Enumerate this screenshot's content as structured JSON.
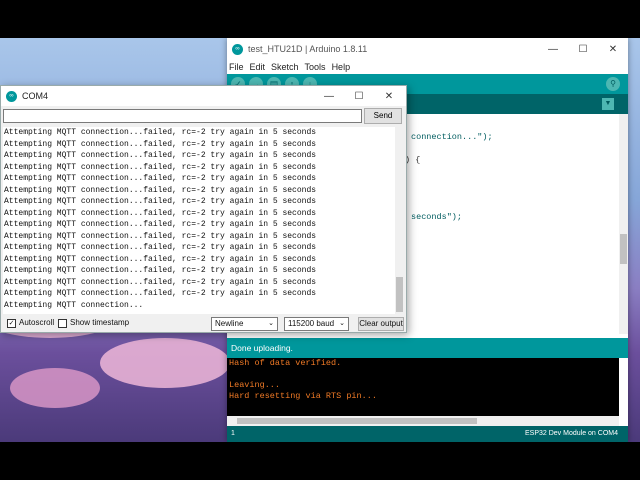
{
  "ide": {
    "title": "test_HTU21D | Arduino 1.8.11",
    "menu": [
      "File",
      "Edit",
      "Sketch",
      "Tools",
      "Help"
    ],
    "editor_fragments": [
      "connection...\");",
      ") {",
      "seconds\");"
    ],
    "status": "Done uploading.",
    "console": [
      "Hash of data verified.",
      "",
      "Leaving...",
      "Hard resetting via RTS pin..."
    ],
    "line_number": "1",
    "board": "ESP32 Dev Module on COM4"
  },
  "serial": {
    "title": "COM4",
    "send_label": "Send",
    "input_value": "",
    "lines": [
      "Attempting MQTT connection...failed, rc=-2 try again in 5 seconds",
      "Attempting MQTT connection...failed, rc=-2 try again in 5 seconds",
      "Attempting MQTT connection...failed, rc=-2 try again in 5 seconds",
      "Attempting MQTT connection...failed, rc=-2 try again in 5 seconds",
      "Attempting MQTT connection...failed, rc=-2 try again in 5 seconds",
      "Attempting MQTT connection...failed, rc=-2 try again in 5 seconds",
      "Attempting MQTT connection...failed, rc=-2 try again in 5 seconds",
      "Attempting MQTT connection...failed, rc=-2 try again in 5 seconds",
      "Attempting MQTT connection...failed, rc=-2 try again in 5 seconds",
      "Attempting MQTT connection...failed, rc=-2 try again in 5 seconds",
      "Attempting MQTT connection...failed, rc=-2 try again in 5 seconds",
      "Attempting MQTT connection...failed, rc=-2 try again in 5 seconds",
      "Attempting MQTT connection...failed, rc=-2 try again in 5 seconds",
      "Attempting MQTT connection...failed, rc=-2 try again in 5 seconds",
      "Attempting MQTT connection...failed, rc=-2 try again in 5 seconds",
      "Attempting MQTT connection..."
    ],
    "autoscroll_label": "Autoscroll",
    "autoscroll_checked": true,
    "timestamp_label": "Show timestamp",
    "timestamp_checked": false,
    "line_ending": "Newline",
    "baud": "115200 baud",
    "clear_label": "Clear output"
  },
  "window_controls": {
    "minimize": "—",
    "maximize": "☐",
    "close": "✕"
  },
  "colors": {
    "arduino_teal": "#00979c",
    "arduino_dark": "#006468",
    "console_orange": "#f07a26"
  }
}
